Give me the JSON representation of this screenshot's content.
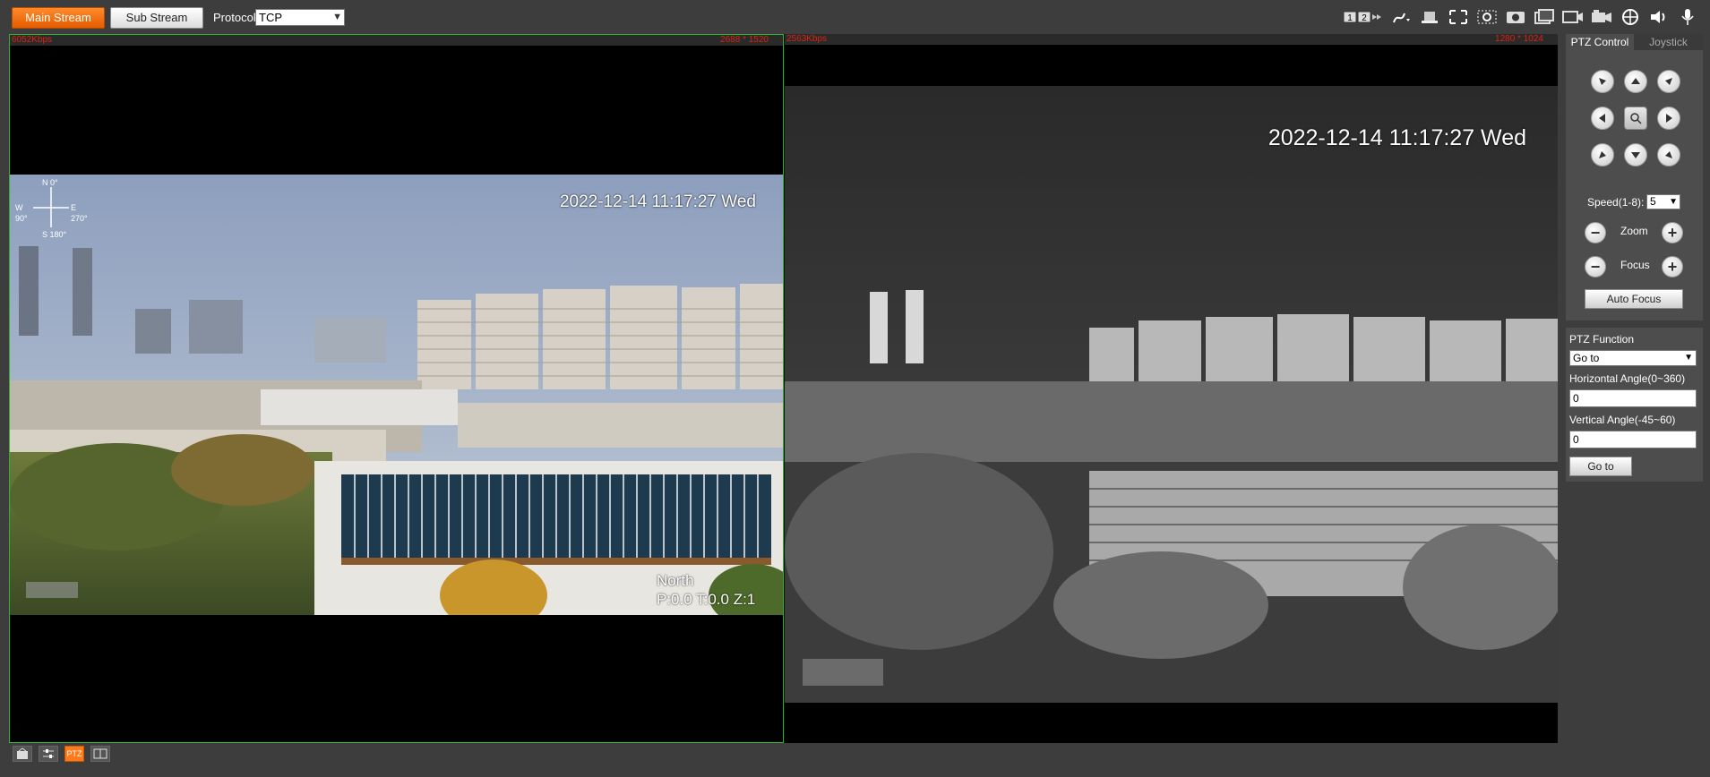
{
  "toolbar": {
    "main_stream": "Main Stream",
    "sub_stream": "Sub Stream",
    "protocol_label": "Protocol",
    "protocol_value": "TCP",
    "icons": [
      "window-split-icon",
      "draw-icon",
      "zoom-icon",
      "fullscreen-icon",
      "region-zoom-icon",
      "snapshot-icon",
      "record-icon",
      "burst-snapshot-icon",
      "video-record-icon",
      "target-icon",
      "audio-icon",
      "mic-icon"
    ],
    "split_labels": [
      "1",
      "2"
    ]
  },
  "video": {
    "left": {
      "bitrate": "6052Kbps",
      "resolution": "2688 * 1520",
      "timestamp": "2022-12-14 11:17:27 Wed",
      "direction": "North",
      "ptz_position": "P:0.0 T:0.0 Z:1",
      "compass": {
        "n": "N 0°",
        "w": "W",
        "w_deg": "90°",
        "e": "E",
        "e_deg": "270°",
        "s": "S 180°"
      }
    },
    "right": {
      "bitrate": "2563Kbps",
      "resolution": "1280 * 1024",
      "timestamp": "2022-12-14 11:17:27 Wed"
    }
  },
  "bottom": {
    "ptz_label": "PTZ"
  },
  "ptz": {
    "tab_control": "PTZ Control",
    "tab_joystick": "Joystick",
    "speed_label": "Speed(1-8):",
    "speed_value": "5",
    "zoom_label": "Zoom",
    "focus_label": "Focus",
    "auto_focus": "Auto Focus"
  },
  "function": {
    "title": "PTZ Function",
    "selected": "Go to",
    "h_label": "Horizontal Angle(0~360)",
    "h_value": "0",
    "v_label": "Vertical Angle(-45~60)",
    "v_value": "0",
    "goto_button": "Go to"
  },
  "colors": {
    "accent": "#ff7a1a",
    "active_border": "#2db52d",
    "info_text": "#dd2211"
  }
}
